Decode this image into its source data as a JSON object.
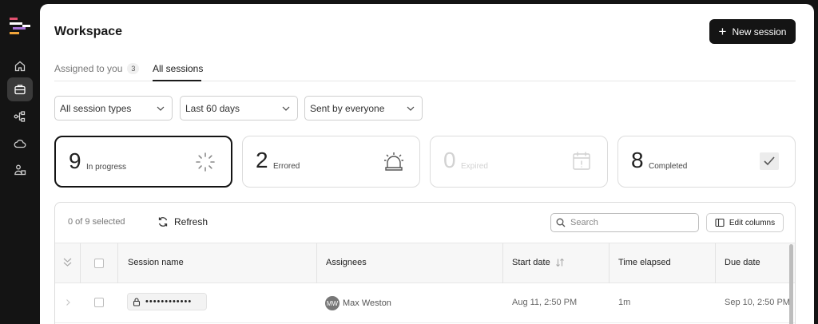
{
  "workspace": {
    "title": "Workspace",
    "new_session_label": "New session"
  },
  "tabs": [
    {
      "label": "Assigned to you",
      "count": "3",
      "active": false
    },
    {
      "label": "All sessions",
      "active": true
    }
  ],
  "filters": [
    {
      "label": "All session types"
    },
    {
      "label": "Last 60 days"
    },
    {
      "label": "Sent by everyone"
    }
  ],
  "stats": [
    {
      "count": "9",
      "label": "In progress",
      "icon": "loading-spinner-icon",
      "selected": true
    },
    {
      "count": "2",
      "label": "Errored",
      "icon": "alarm-siren-icon"
    },
    {
      "count": "0",
      "label": "Expired",
      "icon": "calendar-alert-icon",
      "dimmed": true
    },
    {
      "count": "8",
      "label": "Completed",
      "icon": "checkmark-icon"
    }
  ],
  "toolbar": {
    "selected_text": "0 of 9 selected",
    "refresh_label": "Refresh",
    "search_placeholder": "Search",
    "edit_columns_label": "Edit columns"
  },
  "table": {
    "columns": [
      "Session name",
      "Assignees",
      "Start date",
      "Time elapsed",
      "Due date"
    ],
    "rows": [
      {
        "session_name": "••••••••••••",
        "assignee_initials": "MW",
        "assignee_name": "Max Weston",
        "start_date": "Aug 11, 2:50 PM",
        "time_elapsed": "1m",
        "due_date": "Sep 10, 2:50 PM"
      }
    ]
  },
  "colors": {
    "accent": "#141414",
    "rail_active": "#3a3a3a",
    "border": "#dcdcdc",
    "logo": [
      "#e2506f",
      "#f0a43a",
      "#a874d8",
      "#ffffff"
    ]
  }
}
